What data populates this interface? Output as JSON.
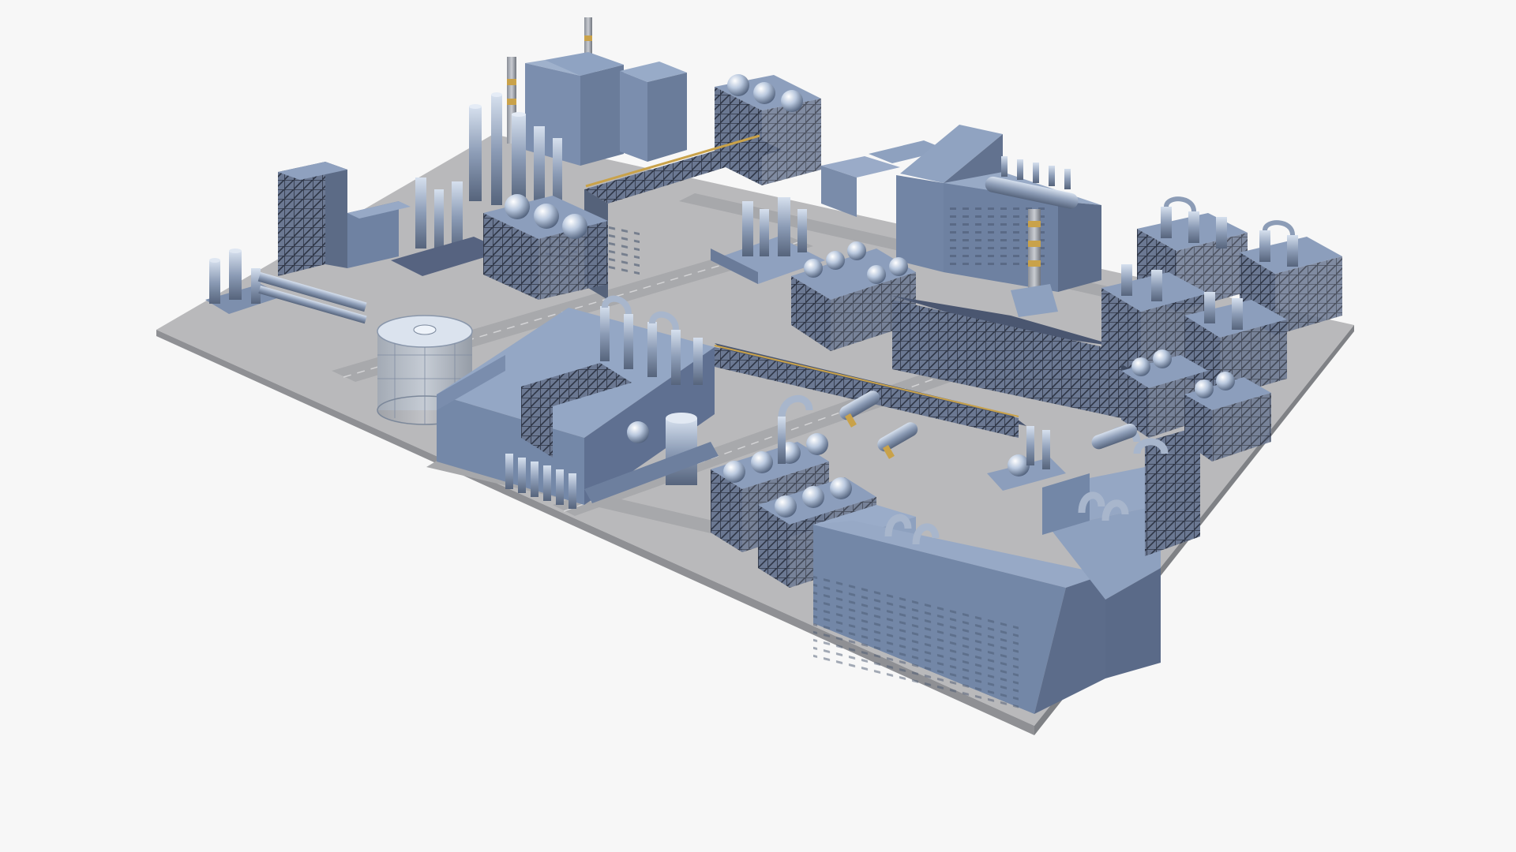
{
  "scene": {
    "subject": "industrial-refinery-3d-model",
    "background": "#f7f7f7",
    "colors": {
      "ground": "#b7b7b9",
      "ground_dark": "#8d8f93",
      "road": "#a9aaad",
      "road_line": "#d4d4d6",
      "building_top": "#8ea2c2",
      "building_side": "#6a7c9a",
      "building_front": "#7e91b1",
      "pipe": "#a9b8cf",
      "pipe_dark": "#4f5d74",
      "frame": "#3a4254",
      "sphere": "#c6d3e6",
      "stripe": "#c9a24a",
      "glass": "#d9e3ef"
    }
  }
}
